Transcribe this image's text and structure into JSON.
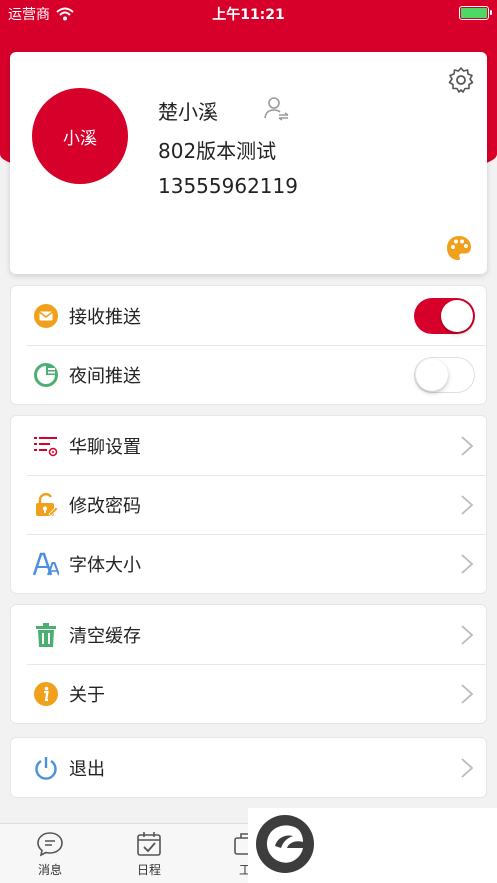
{
  "status": {
    "carrier": "运营商",
    "time": "上午11:21"
  },
  "profile": {
    "avatar_text": "小溪",
    "name": "楚小溪",
    "org": "802版本测试",
    "phone": "13555962119"
  },
  "push": {
    "receive_label": "接收推送",
    "receive_on": true,
    "night_label": "夜间推送",
    "night_on": false
  },
  "settings": {
    "huaLiao_label": "华聊设置",
    "password_label": "修改密码",
    "font_label": "字体大小"
  },
  "misc": {
    "cache_label": "清空缓存",
    "about_label": "关于"
  },
  "logout": {
    "label": "退出"
  },
  "tabs": {
    "messages": "消息",
    "schedule": "日程",
    "work_partial": "工"
  },
  "colors": {
    "brand_red": "#d7002a",
    "orange": "#f0a01a",
    "green": "#4caf72",
    "blue": "#4a8fe0"
  },
  "icons": [
    "wifi-icon",
    "battery-icon",
    "switch-user-icon",
    "gear-icon",
    "palette-icon",
    "mail-icon",
    "moon-icon",
    "list-settings-icon",
    "lock-icon",
    "font-size-icon",
    "trash-icon",
    "info-icon",
    "power-icon",
    "chevron-right-icon",
    "chat-icon",
    "calendar-icon",
    "app-logo-icon"
  ]
}
